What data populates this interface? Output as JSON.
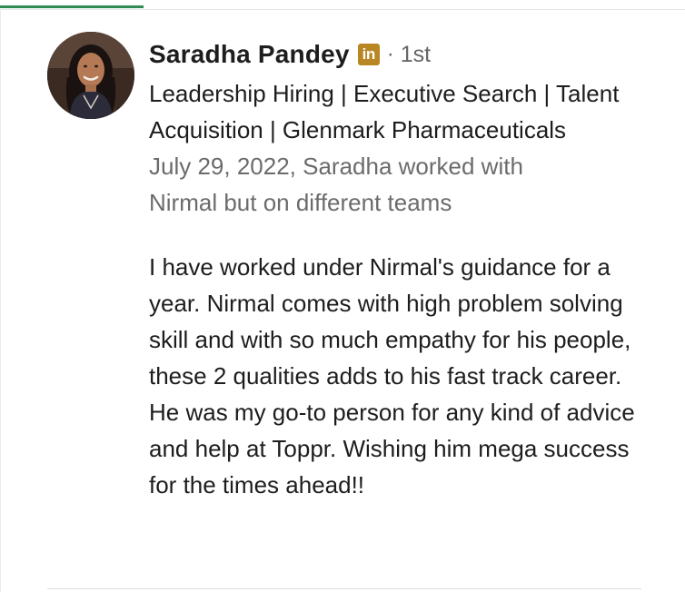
{
  "recommendation": {
    "author_name": "Saradha Pandey",
    "badge_icon": "linkedin-icon",
    "badge_text": "in",
    "separator": "·",
    "connection_degree": "1st",
    "headline": "Leadership Hiring | Executive Search | Talent Acquisition | Glenmark Pharmaceuticals",
    "meta": "July 29, 2022, Saradha worked with Nirmal but on different teams",
    "text": "I have worked under Nirmal's guidance for a year. Nirmal comes with high problem solving skill and with so much empathy for his people, these 2 qualities adds to his fast track career. He was my go-to person for any kind of advice and help at Toppr. Wishing him mega success for the times ahead!!"
  },
  "colors": {
    "tab_indicator": "#2f8a53",
    "badge": "#b88623",
    "secondary_text": "#6b6b6b"
  }
}
